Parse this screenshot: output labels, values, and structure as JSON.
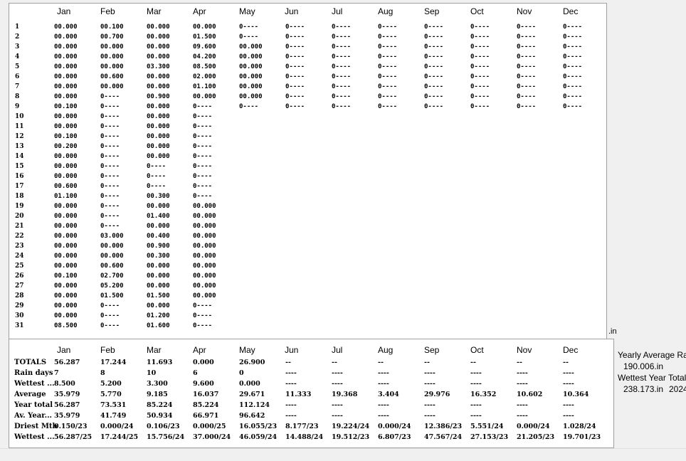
{
  "months": [
    "Jan",
    "Feb",
    "Mar",
    "Apr",
    "May",
    "Jun",
    "Jul",
    "Aug",
    "Sep",
    "Oct",
    "Nov",
    "Dec"
  ],
  "days": [
    "1",
    "2",
    "3",
    "4",
    "5",
    "6",
    "7",
    "8",
    "9",
    "10",
    "11",
    "12",
    "13",
    "14",
    "15",
    "16",
    "17",
    "18",
    "19",
    "20",
    "21",
    "22",
    "23",
    "24",
    "25",
    "26",
    "27",
    "28",
    "29",
    "30",
    "31"
  ],
  "daily": {
    "Jan": [
      "00.000",
      "00.000",
      "00.000",
      "00.000",
      "00.000",
      "00.000",
      "00.000",
      "00.000",
      "00.100",
      "00.000",
      "00.000",
      "00.100",
      "00.200",
      "00.000",
      "00.000",
      "00.000",
      "00.600",
      "01.100",
      "00.000",
      "00.000",
      "00.000",
      "00.000",
      "00.000",
      "00.000",
      "00.000",
      "00.100",
      "00.000",
      "00.000",
      "00.000",
      "00.000",
      "08.500"
    ],
    "Feb": [
      "00.100",
      "00.700",
      "00.000",
      "00.000",
      "00.000",
      "00.600",
      "00.000",
      "0----",
      "0----",
      "0----",
      "0----",
      "0----",
      "0----",
      "0----",
      "0----",
      "0----",
      "0----",
      "0----",
      "0----",
      "0----",
      "0----",
      "03.000",
      "00.000",
      "00.000",
      "00.600",
      "02.700",
      "05.200",
      "01.500",
      "0----",
      "0----",
      "0----"
    ],
    "Mar": [
      "00.000",
      "00.000",
      "00.000",
      "00.000",
      "03.300",
      "00.000",
      "00.000",
      "00.900",
      "00.000",
      "00.000",
      "00.000",
      "00.000",
      "00.000",
      "00.000",
      "0----",
      "0----",
      "0----",
      "00.300",
      "00.000",
      "01.400",
      "00.000",
      "00.400",
      "00.900",
      "00.300",
      "00.000",
      "00.000",
      "00.000",
      "01.500",
      "00.000",
      "01.200",
      "01.600"
    ],
    "Apr": [
      "00.000",
      "01.500",
      "09.600",
      "04.200",
      "08.500",
      "02.000",
      "01.100",
      "00.000",
      "0----",
      "0----",
      "0----",
      "0----",
      "0----",
      "0----",
      "0----",
      "0----",
      "0----",
      "0----",
      "00.000",
      "00.000",
      "00.000",
      "00.000",
      "00.000",
      "00.000",
      "00.000",
      "00.000",
      "00.000",
      "00.000",
      "0----",
      "0----",
      "0----"
    ],
    "May": [
      "0----",
      "0----",
      "00.000",
      "00.000",
      "00.000",
      "00.000",
      "00.000",
      "00.000",
      "0----"
    ],
    "Jun": [
      "0----",
      "0----",
      "0----",
      "0----",
      "0----",
      "0----",
      "0----",
      "0----",
      "0----"
    ],
    "Jul": [
      "0----",
      "0----",
      "0----",
      "0----",
      "0----",
      "0----",
      "0----",
      "0----",
      "0----"
    ],
    "Aug": [
      "0----",
      "0----",
      "0----",
      "0----",
      "0----",
      "0----",
      "0----",
      "0----",
      "0----"
    ],
    "Sep": [
      "0----",
      "0----",
      "0----",
      "0----",
      "0----",
      "0----",
      "0----",
      "0----",
      "0----"
    ],
    "Oct": [
      "0----",
      "0----",
      "0----",
      "0----",
      "0----",
      "0----",
      "0----",
      "0----",
      "0----"
    ],
    "Nov": [
      "0----",
      "0----",
      "0----",
      "0----",
      "0----",
      "0----",
      "0----",
      "0----",
      "0----"
    ],
    "Dec": [
      "0----",
      "0----",
      "0----",
      "0----",
      "0----",
      "0----",
      "0----",
      "0----",
      "0----"
    ]
  },
  "unit_label": ".in",
  "summary": {
    "rows": [
      {
        "label": "TOTALS",
        "values": [
          "56.287",
          "17.244",
          "11.693",
          "0.000",
          "26.900",
          "--",
          "--",
          "--",
          "--",
          "--",
          "--",
          "--"
        ]
      },
      {
        "label": "Rain days",
        "values": [
          "7",
          "8",
          "10",
          "6",
          "0",
          "----",
          "----",
          "----",
          "----",
          "----",
          "----",
          "----"
        ]
      },
      {
        "label": "Wettest ...",
        "values": [
          "8.500",
          "5.200",
          "3.300",
          "9.600",
          "0.000",
          "----",
          "----",
          "----",
          "----",
          "----",
          "----",
          "----"
        ]
      },
      {
        "label": "Average",
        "values": [
          "35.979",
          "5.770",
          "9.185",
          "16.037",
          "29.671",
          "11.333",
          "19.368",
          "3.404",
          "29.976",
          "16.352",
          "10.602",
          "10.364"
        ]
      },
      {
        "label": "Year total",
        "values": [
          "56.287",
          "73.531",
          "85.224",
          "85.224",
          "112.124",
          "----",
          "----",
          "----",
          "----",
          "----",
          "----",
          "----"
        ]
      },
      {
        "label": "Av. Year...",
        "values": [
          "35.979",
          "41.749",
          "50.934",
          "66.971",
          "96.642",
          "----",
          "----",
          "----",
          "----",
          "----",
          "----",
          "----"
        ]
      },
      {
        "label": "Driest Mth",
        "values": [
          "0.150/23",
          "0.000/24",
          "0.106/23",
          "0.000/25",
          "16.055/23",
          "8.177/23",
          "19.224/24",
          "0.000/24",
          "12.386/23",
          "5.551/24",
          "0.000/24",
          "1.028/24"
        ]
      },
      {
        "label": "Wettest ...",
        "values": [
          "56.287/25",
          "17.244/25",
          "15.756/24",
          "37.000/24",
          "46.059/24",
          "14.488/24",
          "19.512/23",
          "6.807/23",
          "47.567/24",
          "27.153/23",
          "21.205/23",
          "19.701/23"
        ]
      }
    ]
  },
  "side": {
    "yearly_avg_label": "Yearly Average Rain",
    "yearly_avg_value": "190.006.in",
    "wettest_label": "Wettest Year Total",
    "wettest_value": "238.173.in",
    "wettest_year": "2024"
  }
}
